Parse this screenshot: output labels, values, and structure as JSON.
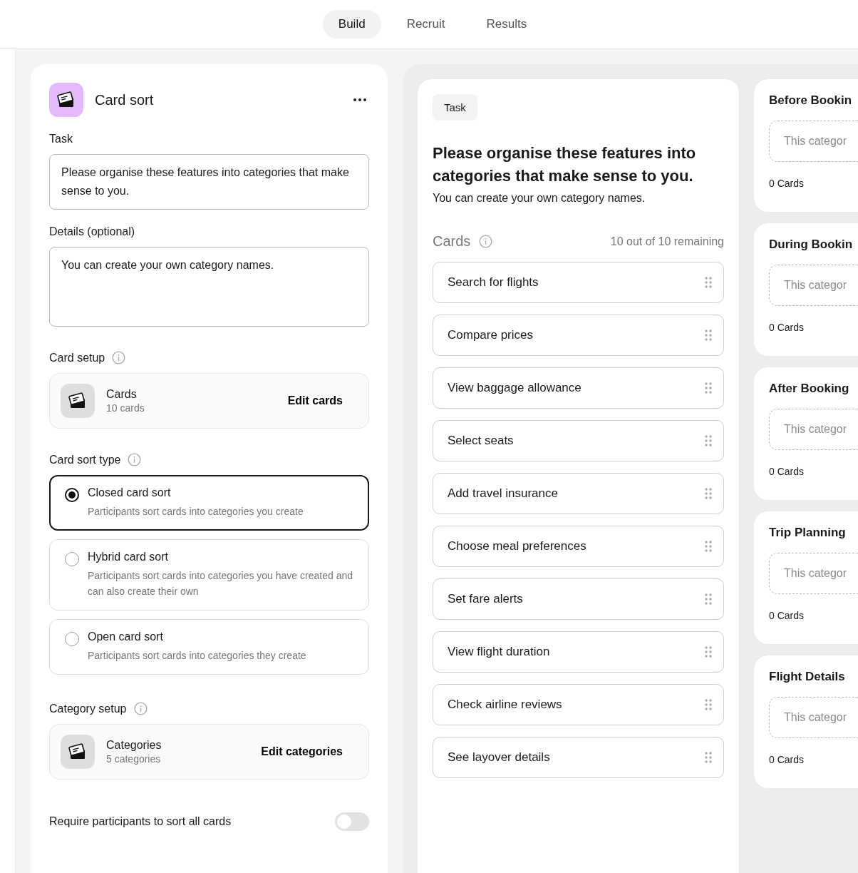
{
  "nav_tabs": [
    {
      "label": "Build",
      "selected": true
    },
    {
      "label": "Recruit",
      "selected": false
    },
    {
      "label": "Results",
      "selected": false
    }
  ],
  "editor": {
    "title": "Card sort",
    "task_label": "Task",
    "task_value": "Please organise these features into categories that make sense to you.",
    "details_label": "Details (optional)",
    "details_value": "You can create your own category names.",
    "card_setup": {
      "label": "Card setup",
      "title": "Cards",
      "count": "10 cards",
      "action": "Edit cards"
    },
    "sort_type": {
      "label": "Card sort type",
      "options": [
        {
          "title": "Closed card sort",
          "description": "Participants sort cards into categories you create",
          "selected": true
        },
        {
          "title": "Hybrid card sort",
          "description": "Participants sort cards into categories you have created and can also create their own",
          "selected": false
        },
        {
          "title": "Open card sort",
          "description": "Participants sort cards into categories they create",
          "selected": false
        }
      ]
    },
    "category_setup": {
      "label": "Category setup",
      "title": "Categories",
      "count": "5 categories",
      "action": "Edit categories"
    },
    "require_all": {
      "label": "Require participants to sort all cards",
      "on": false
    }
  },
  "preview": {
    "badge": "Task",
    "heading": "Please organise these features into categories that make sense to you.",
    "subheading": "You can create your own category names.",
    "cards_label": "Cards",
    "remaining": "10 out of 10 remaining",
    "cards": [
      "Search for flights",
      "Compare prices",
      "View baggage allowance",
      "Select seats",
      "Add travel insurance",
      "Choose meal preferences",
      "Set fare alerts",
      "View flight duration",
      "Check airline reviews",
      "See layover details"
    ]
  },
  "categories": [
    {
      "name": "Before Bookin",
      "placeholder": "This categor",
      "count": "0 Cards"
    },
    {
      "name": "During Bookin",
      "placeholder": "This categor",
      "count": "0 Cards"
    },
    {
      "name": "After Booking",
      "placeholder": "This categor",
      "count": "0 Cards"
    },
    {
      "name": "Trip Planning",
      "placeholder": "This categor",
      "count": "0 Cards"
    },
    {
      "name": "Flight Details",
      "placeholder": "This categor",
      "count": "0 Cards"
    }
  ]
}
